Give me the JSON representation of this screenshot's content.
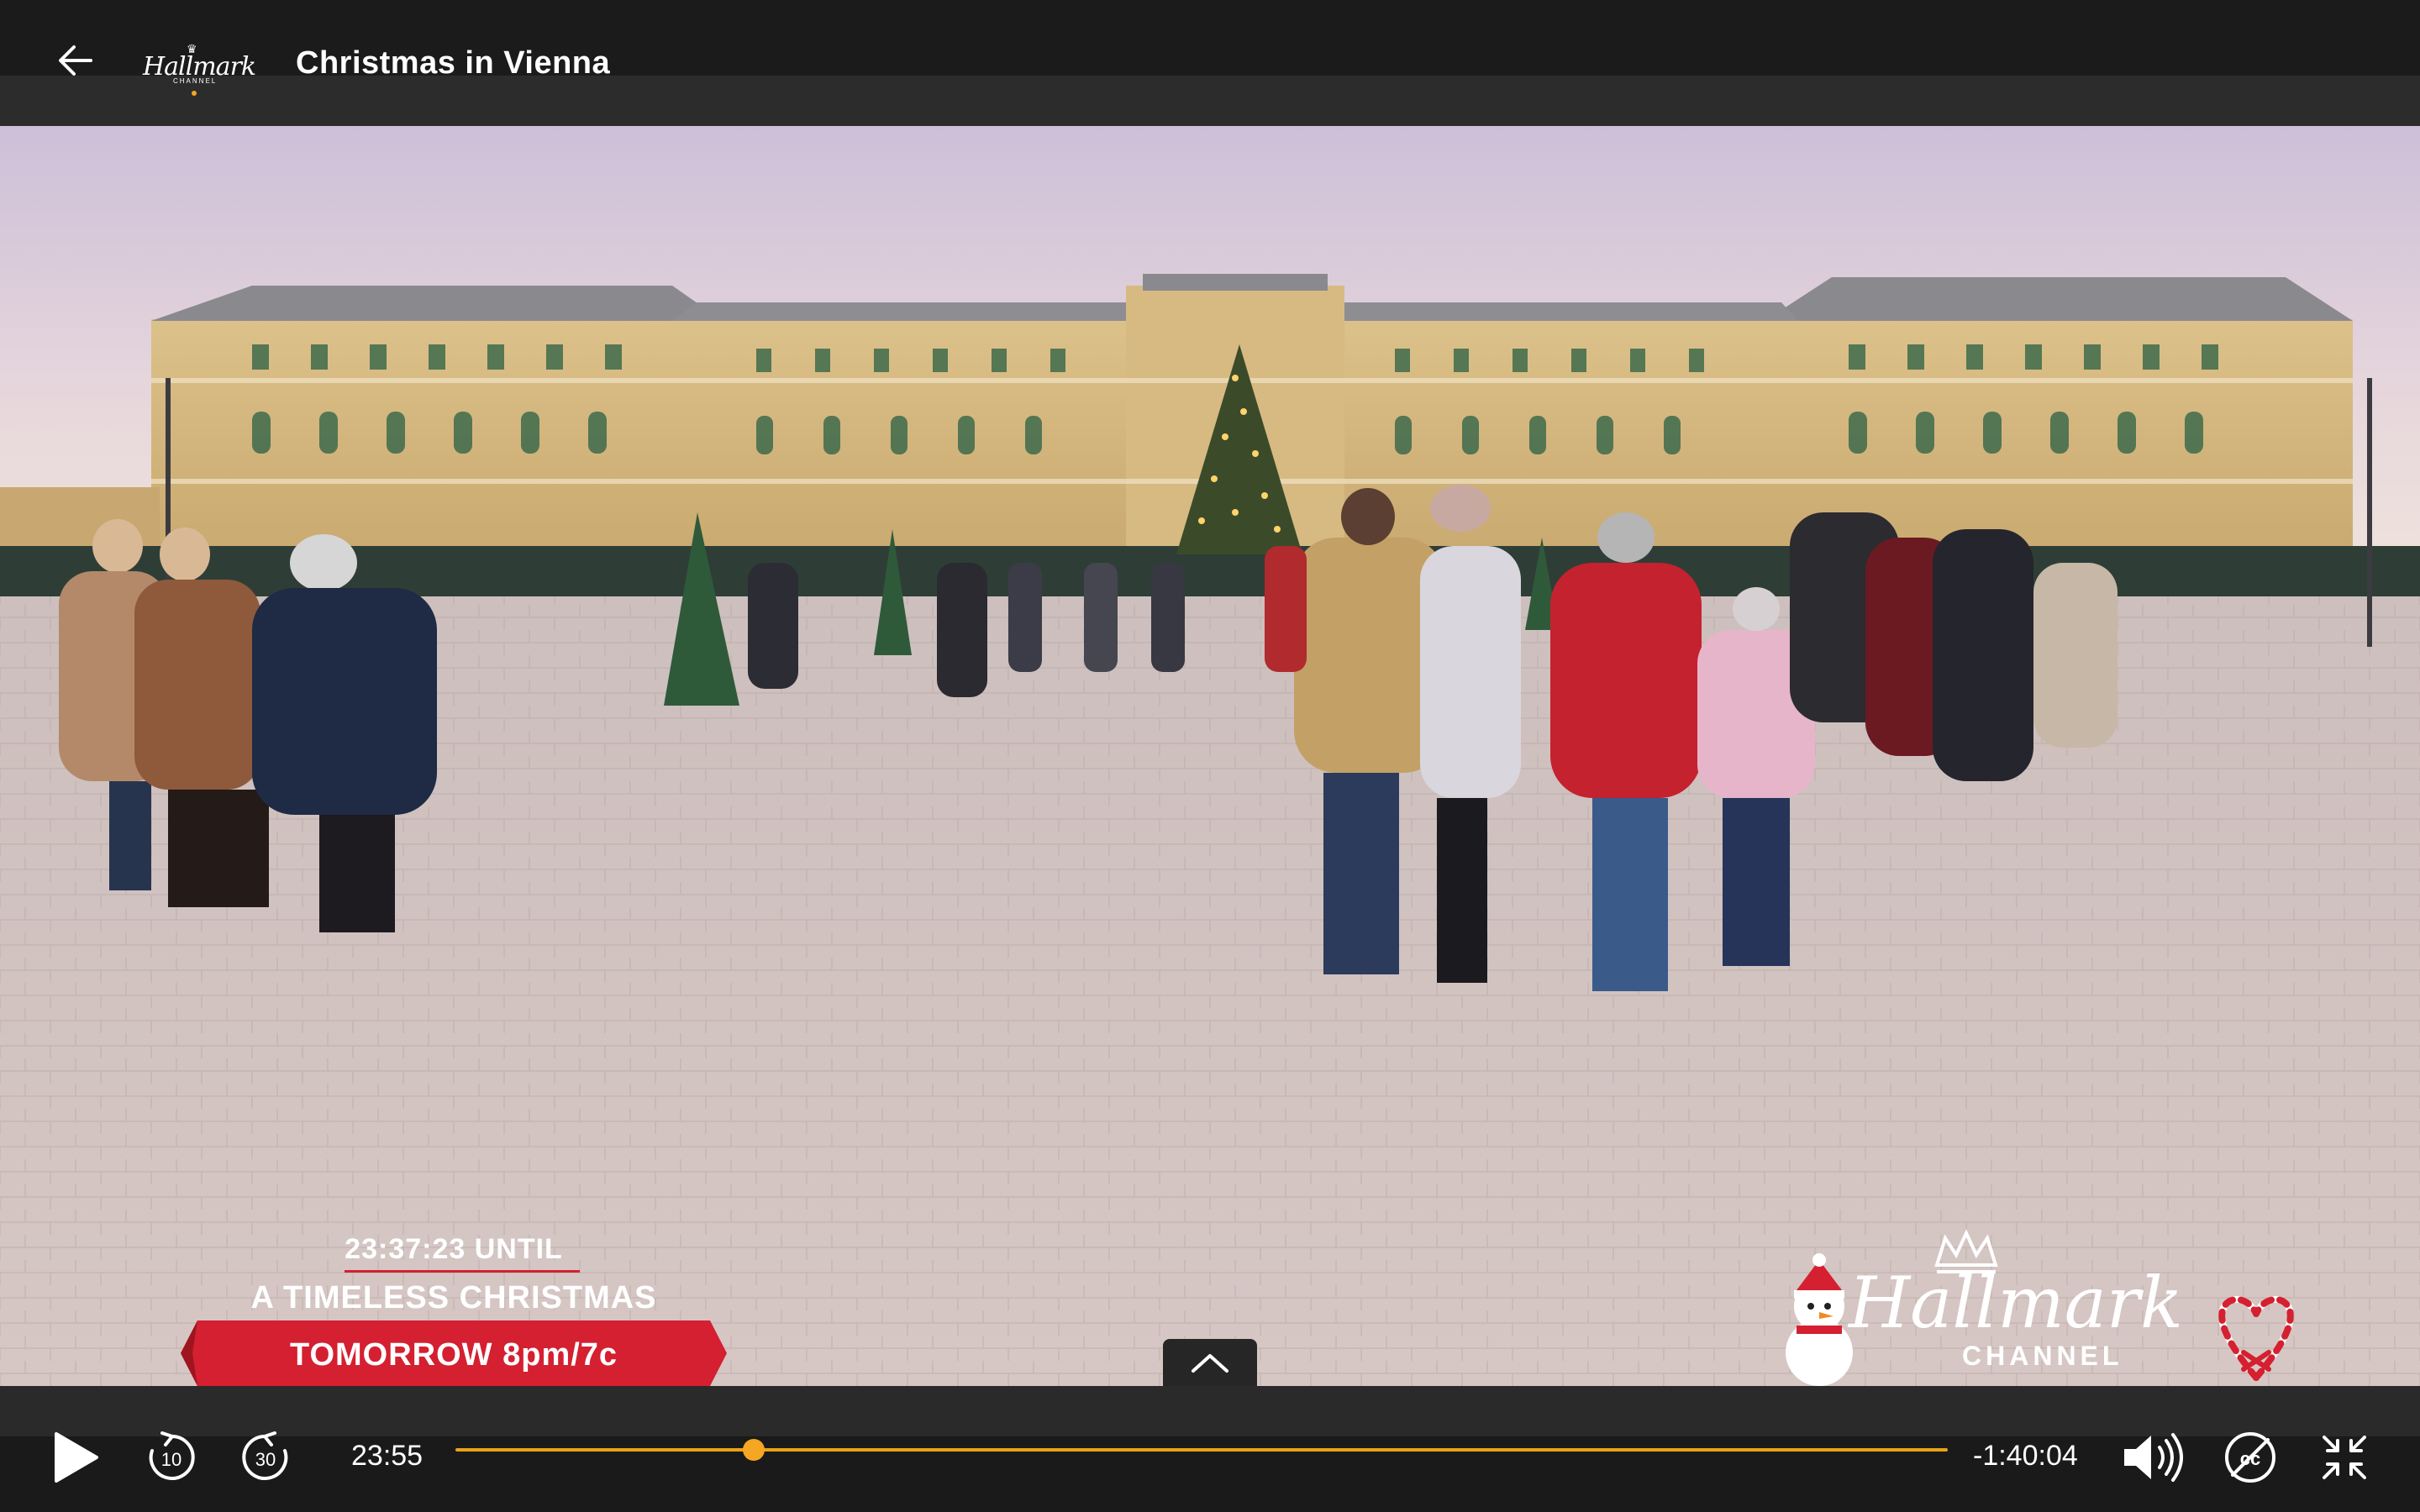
{
  "header": {
    "title": "Christmas in Vienna",
    "logo_text": "Hallmark",
    "logo_subtext": "CHANNEL",
    "back_icon": "arrow-left-icon"
  },
  "promo": {
    "countdown": "23:37:23 UNTIL",
    "program": "A TIMELESS CHRISTMAS",
    "airtime": "TOMORROW 8pm/7c",
    "banner_color": "#d42030"
  },
  "watermark": {
    "brand": "Hallmark",
    "sub": "CHANNEL"
  },
  "player": {
    "elapsed": "23:55",
    "remaining": "-1:40:04",
    "progress_fraction": 0.2,
    "rewind_seconds": "10",
    "forward_seconds": "30",
    "accent_color": "#f5a623",
    "icons": {
      "play": "play-icon",
      "rewind": "rewind-10-icon",
      "forward": "forward-30-icon",
      "volume": "volume-icon",
      "captions": "captions-off-icon",
      "exit_fullscreen": "exit-fullscreen-icon",
      "expand": "chevron-up-icon"
    }
  }
}
